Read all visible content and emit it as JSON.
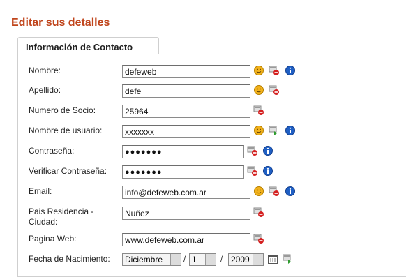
{
  "page": {
    "title": "Editar sus detalles"
  },
  "tab": {
    "label": "Información de Contacto"
  },
  "fields": {
    "nombre": {
      "label": "Nombre:",
      "value": "defeweb"
    },
    "apellido": {
      "label": "Apellido:",
      "value": "defe"
    },
    "socio": {
      "label": "Numero de Socio:",
      "value": "25964"
    },
    "usuario": {
      "label": "Nombre de usuario:",
      "value": "xxxxxxx"
    },
    "contrasena": {
      "label": "Contraseña:",
      "value": "●●●●●●●"
    },
    "verificar": {
      "label": "Verificar Contraseña:",
      "value": "●●●●●●●"
    },
    "email": {
      "label": "Email:",
      "value": "info@defeweb.com.ar"
    },
    "pais": {
      "label": "Pais Residencia - Ciudad:",
      "value": "Nuñez"
    },
    "web": {
      "label": "Pagina Web:",
      "value": "www.defeweb.com.ar"
    },
    "fecha": {
      "label": "Fecha de Nacimiento:",
      "month": "Diciembre",
      "day": "1",
      "year": "2009",
      "separator": "/"
    }
  },
  "icons": {
    "smiley": "smiley-icon",
    "delete": "delete-icon",
    "info": "info-icon",
    "calendar": "calendar-icon",
    "approve": "approve-icon"
  },
  "colors": {
    "title": "#c0451c",
    "info": "#1f5fc4",
    "delete": "#d42020",
    "smiley": "#f2b21c"
  }
}
